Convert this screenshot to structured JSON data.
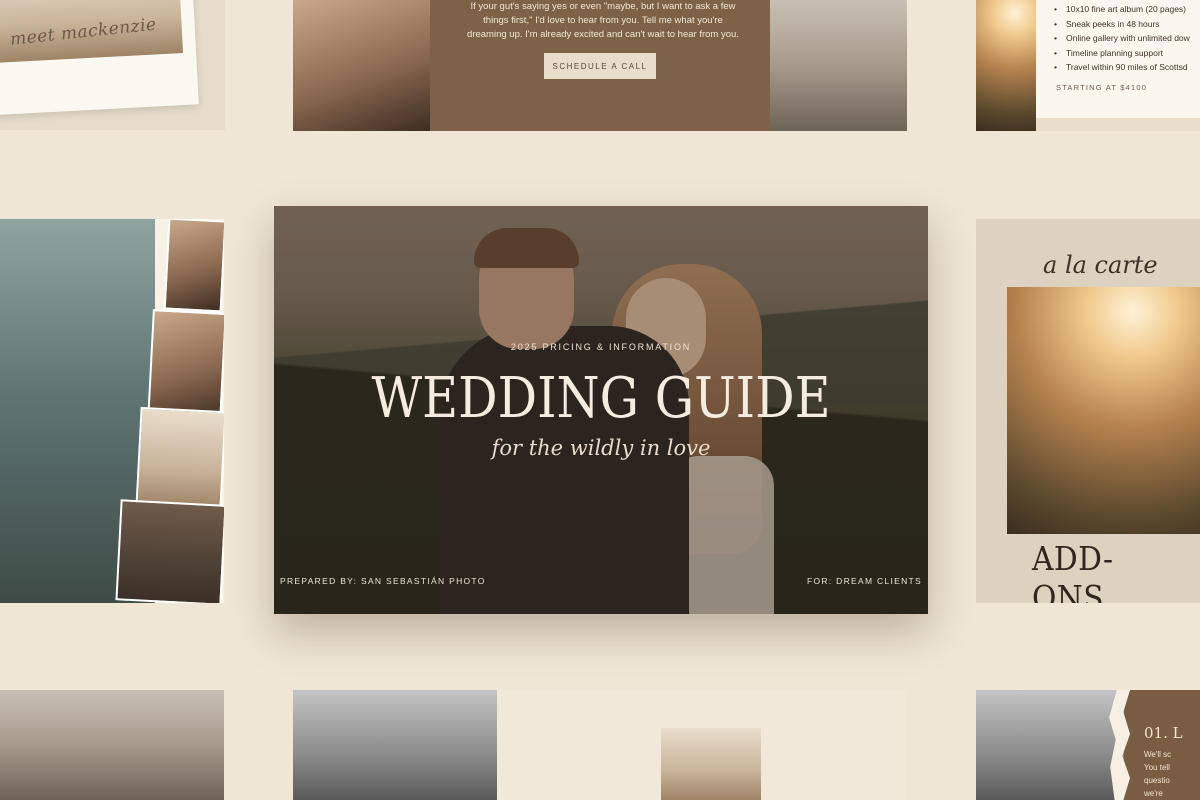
{
  "top_left": {
    "script_name": "meet mackenzie"
  },
  "top_middle": {
    "copy_lines": [
      "If your gut's saying yes or even \"maybe, but I want to ask a few",
      "things first,\" I'd love to hear from you. Tell me what you're",
      "dreaming up. I'm already excited and can't wait to hear from you."
    ],
    "cta_label": "SCHEDULE A CALL"
  },
  "top_right": {
    "items": [
      "10x10 fine art album (20 pages)",
      "Sneak peeks in 48 hours",
      "Online gallery with unlimited dow",
      "Timeline planning support",
      "Travel within 90 miles of Scottsd"
    ],
    "starting": "STARTING AT $4100"
  },
  "hero": {
    "kicker": "2025 PRICING & INFORMATION",
    "title": "WEDDING GUIDE",
    "subtitle": "for the wildly in love",
    "prepared_by": "PREPARED BY: SAN SEBASTIÁN PHOTO",
    "for": "FOR: DREAM CLIENTS"
  },
  "right_addons": {
    "script": "a la carte",
    "heading": "ADD-ONS"
  },
  "bottom_right": {
    "number": "01. L",
    "lines": [
      "We'll sc",
      "You tell",
      "questio",
      "we're"
    ]
  }
}
